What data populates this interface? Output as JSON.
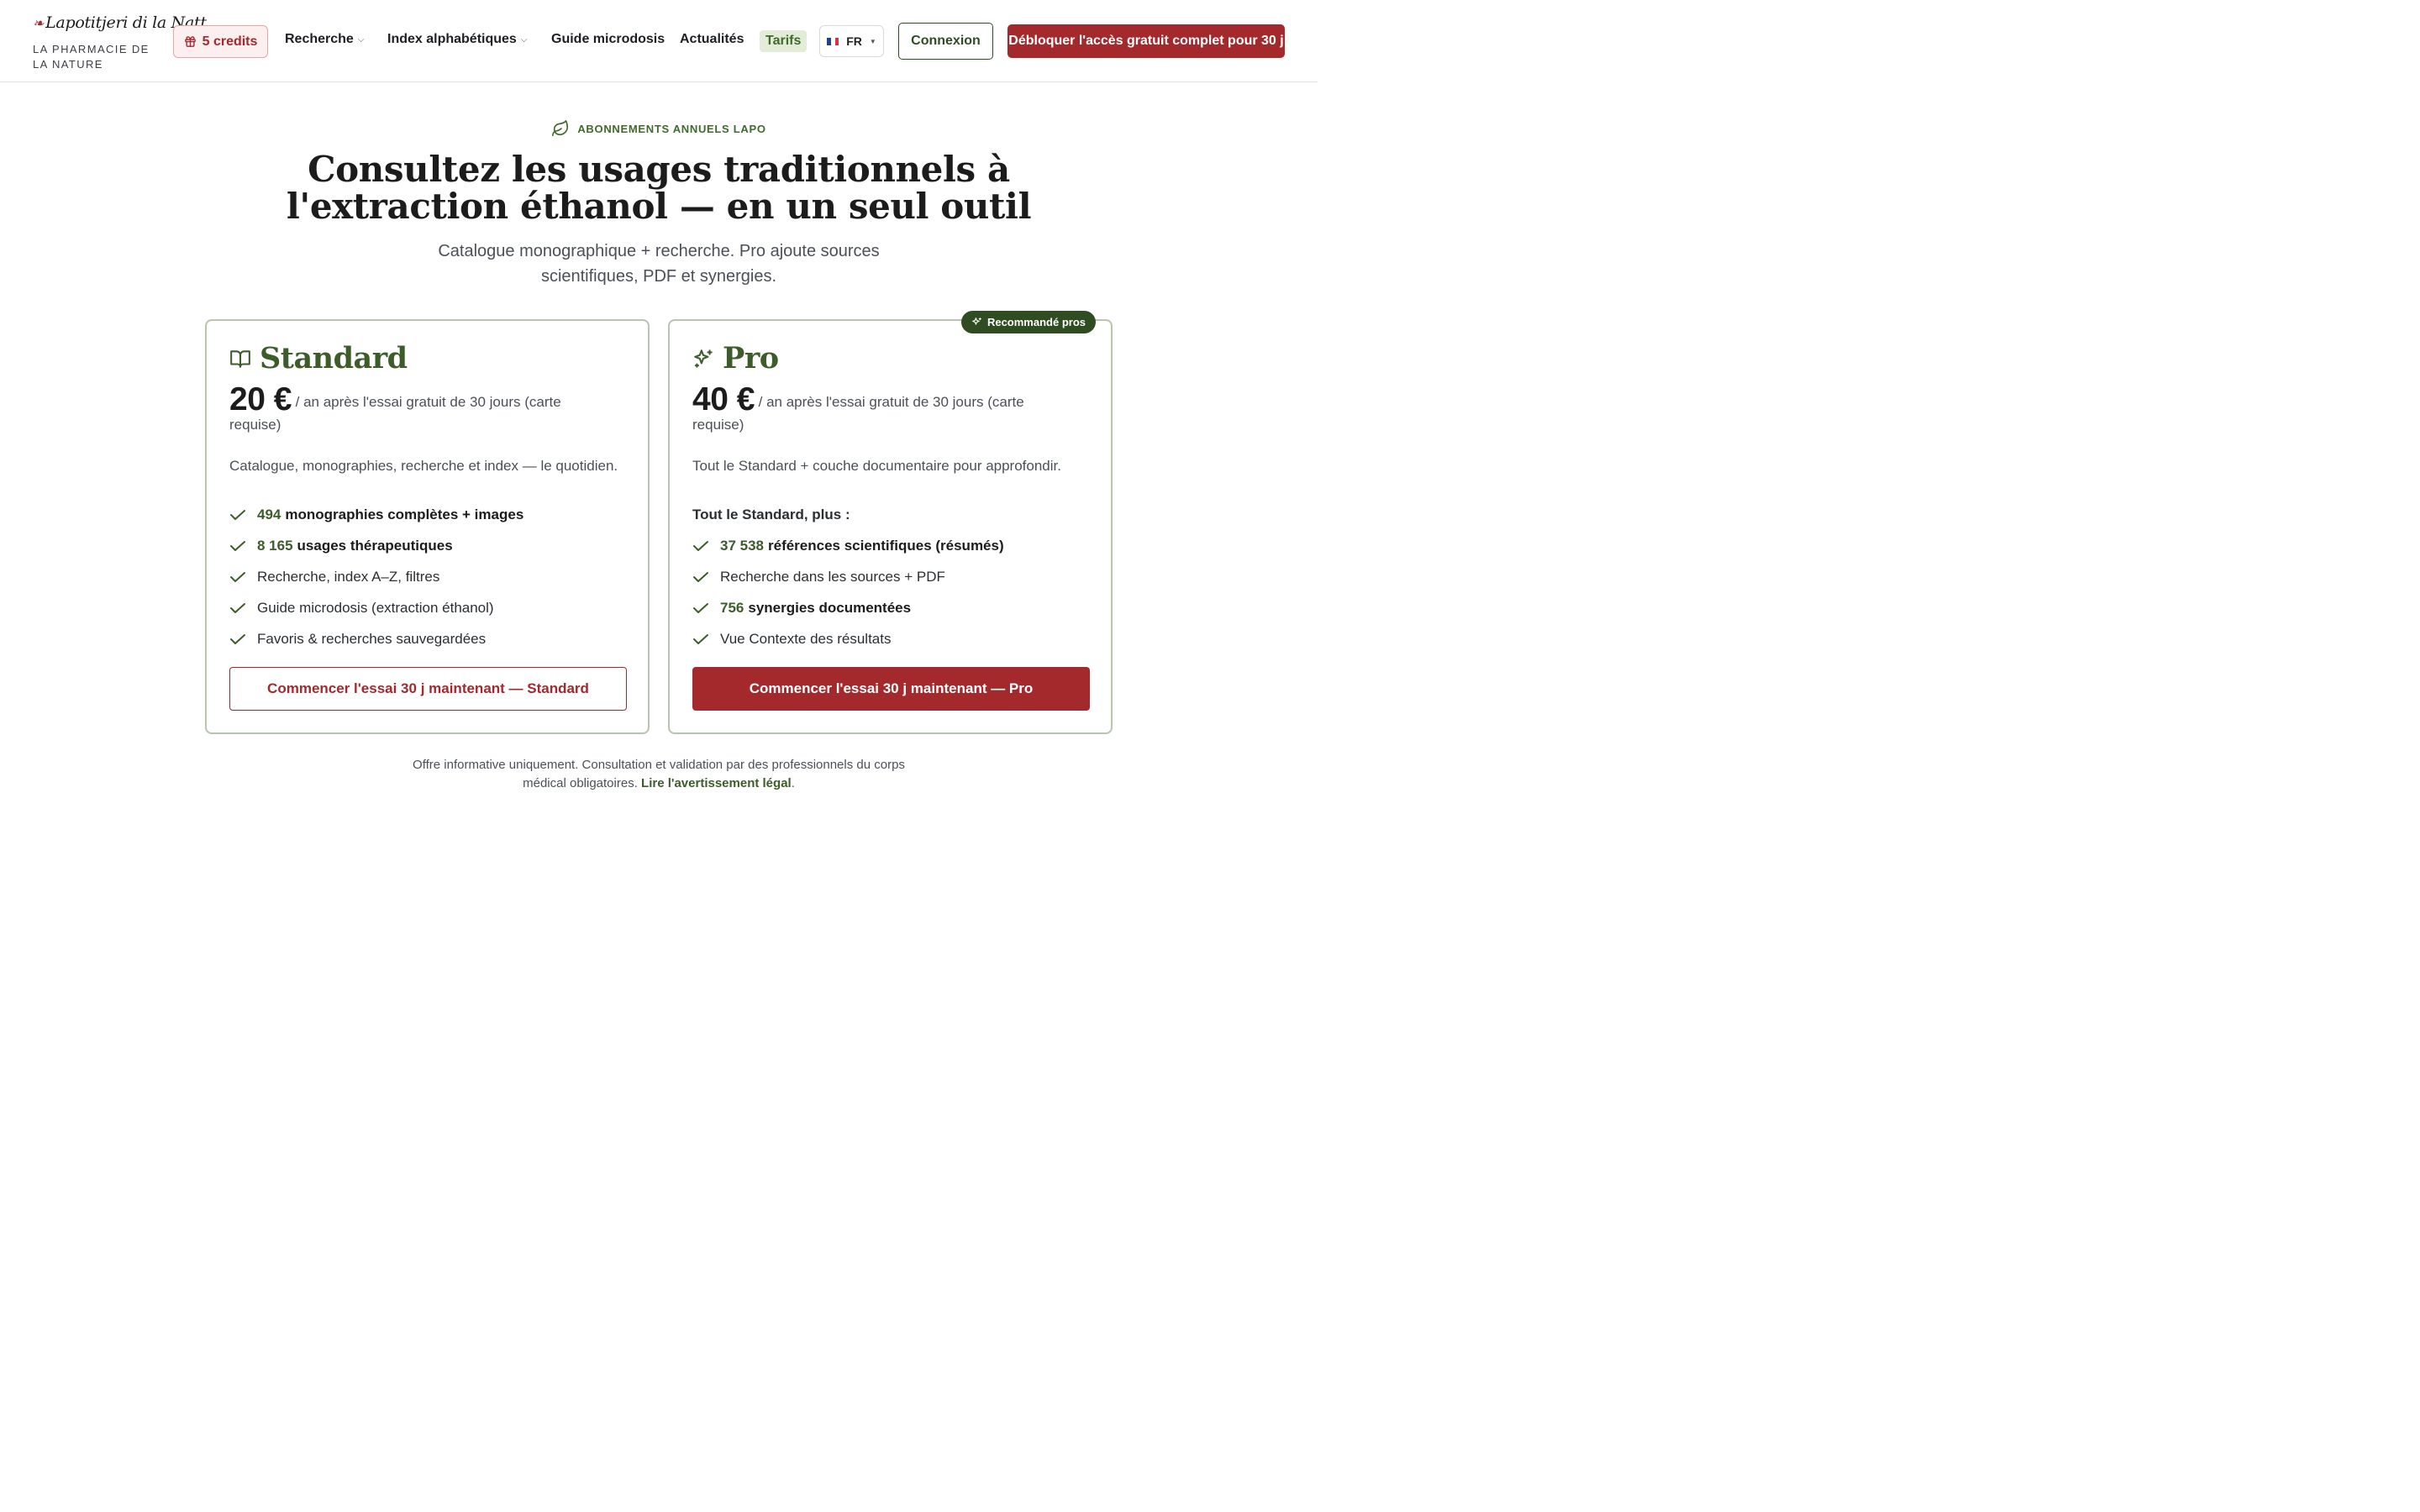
{
  "header": {
    "brand_logo": "Lapotitjeri di la Natt",
    "brand_subtitle": "LA PHARMACIE DE LA NATURE",
    "credits_label": "5 credits",
    "nav": [
      {
        "label": "Recherche",
        "has_dropdown": true
      },
      {
        "label": "Index alphabétiques",
        "has_dropdown": true
      },
      {
        "label": "Guide microdosis",
        "has_dropdown": false
      },
      {
        "label": "Actualités",
        "has_dropdown": false
      },
      {
        "label": "Tarifs",
        "active": true
      }
    ],
    "language": "FR",
    "login_label": "Connexion",
    "unlock_label": "Débloquer l'accès gratuit complet pour 30 j"
  },
  "hero": {
    "eyebrow": "ABONNEMENTS ANNUELS LAPO",
    "title": "Consultez les usages traditionnels à l'extraction éthanol — en un seul outil",
    "subtitle": "Catalogue monographique + recherche. Pro ajoute sources scientifiques, PDF et synergies."
  },
  "plans": {
    "standard": {
      "name": "Standard",
      "price": "20 €",
      "price_note": "/ an après l'essai gratuit de 30 jours (carte requise)",
      "description": "Catalogue, monographies, recherche et index — le quotidien.",
      "features": [
        {
          "num": "494",
          "text": "monographies complètes + images"
        },
        {
          "num": "8 165",
          "text": "usages thérapeutiques"
        },
        {
          "text": "Recherche, index A–Z, filtres"
        },
        {
          "text": "Guide microdosis (extraction éthanol)"
        },
        {
          "text": "Favoris & recherches sauvegardées"
        }
      ],
      "cta": "Commencer l'essai 30 j maintenant — Standard"
    },
    "pro": {
      "badge": "Recommandé pros",
      "name": "Pro",
      "price": "40 €",
      "price_note": "/ an après l'essai gratuit de 30 jours (carte requise)",
      "description": "Tout le Standard + couche documentaire pour approfondir.",
      "plus_label": "Tout le Standard, plus :",
      "features": [
        {
          "num": "37 538",
          "text": "références scientifiques (résumés)"
        },
        {
          "text": "Recherche dans les sources + PDF"
        },
        {
          "num": "756",
          "text": "synergies documentées"
        },
        {
          "text": "Vue Contexte des résultats"
        }
      ],
      "cta": "Commencer l'essai 30 j maintenant — Pro"
    }
  },
  "footnote": {
    "text": "Offre informative uniquement. Consultation et validation par des professionnels du corps médical obligatoires.",
    "link": "Lire l'avertissement légal",
    "end": "."
  },
  "colors": {
    "brand_red": "#a3292d",
    "brand_green": "#3c5d2a",
    "badge_green": "#2f4d21",
    "card_border": "#b9c4ad"
  }
}
